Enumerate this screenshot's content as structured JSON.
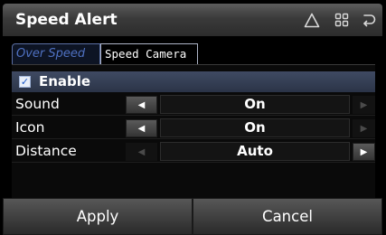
{
  "title": "Speed Alert",
  "titlebar_icons": [
    "warning-triangle-icon",
    "grid-menu-icon",
    "back-icon"
  ],
  "tabs": [
    {
      "label": "Over Speed",
      "active": false
    },
    {
      "label": "Speed Camera",
      "active": true
    }
  ],
  "enable": {
    "label": "Enable",
    "checked": true
  },
  "settings": [
    {
      "label": "Sound",
      "value": "On",
      "left_enabled": true,
      "right_enabled": false
    },
    {
      "label": "Icon",
      "value": "On",
      "left_enabled": true,
      "right_enabled": false
    },
    {
      "label": "Distance",
      "value": "Auto",
      "left_enabled": false,
      "right_enabled": true
    }
  ],
  "buttons": {
    "apply": "Apply",
    "cancel": "Cancel"
  },
  "glyphs": {
    "left_arrow": "◀",
    "right_arrow": "▶",
    "check": "✓"
  }
}
